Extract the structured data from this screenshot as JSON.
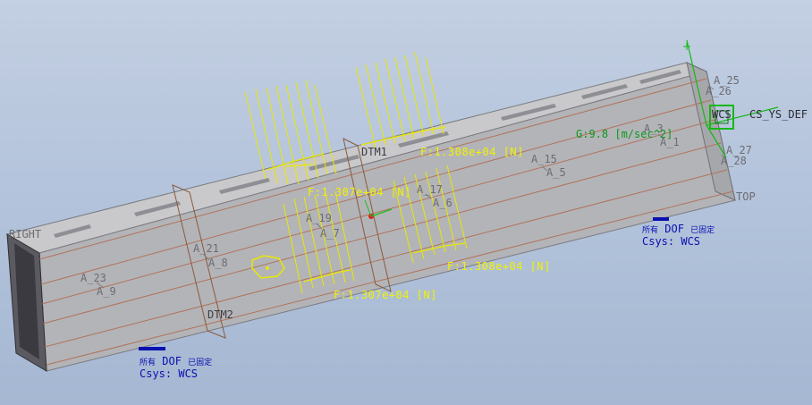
{
  "view": {
    "background_top": "#c3cfe2",
    "background_bottom": "#a5b7d2"
  },
  "datum_planes": {
    "right": "RIGHT",
    "top": "TOP",
    "dtm1": "DTM1",
    "dtm2": "DTM2"
  },
  "csys": {
    "def": "CS_YS_DEF",
    "wcs": "WCS"
  },
  "axes": {
    "a23": "A_23",
    "a9": "A_9",
    "a21": "A_21",
    "a8": "A_8",
    "a19": "A_19",
    "a7": "A_7",
    "a17": "A_17",
    "a6": "A_6",
    "a15": "A_15",
    "a5": "A_5",
    "a3": "A_3",
    "a1": "A_1",
    "a25": "A_25",
    "a26": "A_26",
    "a27": "A_27",
    "a28": "A_28"
  },
  "loads": {
    "f1": "F:1.307e+04 [N]",
    "f2": "F:1.308e+04 [N]",
    "f3": "F:1.308e+04 [N]",
    "f4": "F:1.307e+04 [N]",
    "color": "#f2f200"
  },
  "gravity": {
    "label": "G:9.8 [m/sec^2]",
    "color": "#0a9a1a"
  },
  "constraints": {
    "c1": {
      "dof_prefix": "所有",
      "dof": "DOF",
      "dof_suffix": "已固定",
      "csys": "Csys: WCS"
    },
    "c2": {
      "dof_prefix": "所有",
      "dof": "DOF",
      "dof_suffix": "已固定",
      "csys": "Csys: WCS"
    },
    "color": "#0a10b0"
  }
}
